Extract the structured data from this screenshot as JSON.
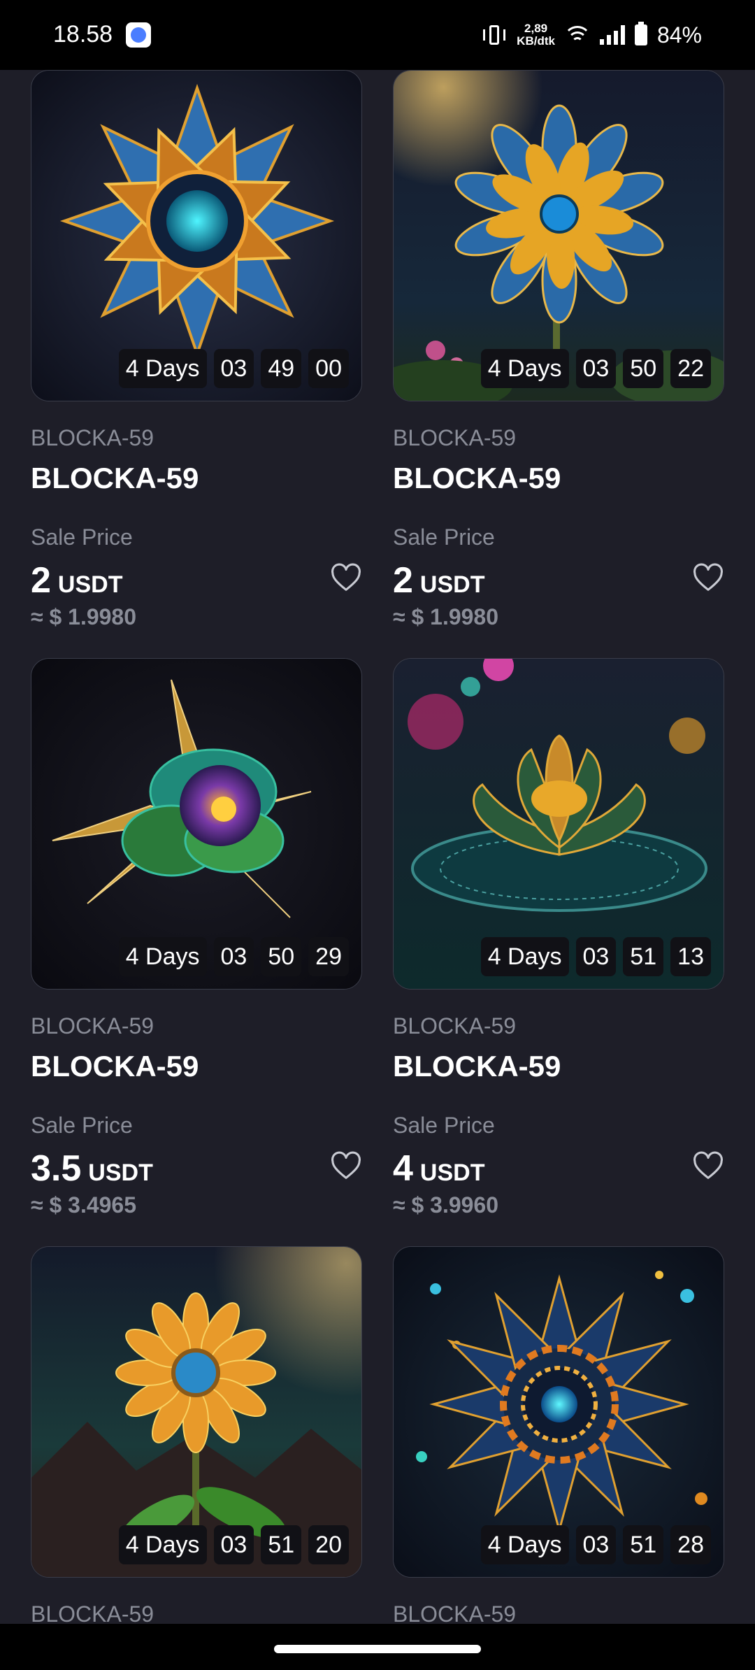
{
  "status_bar": {
    "time": "18.58",
    "net_speed_value": "2,89",
    "net_speed_unit": "KB/dtk",
    "battery": "84%"
  },
  "cards": [
    {
      "collection": "BLOCKA-59",
      "title": "BLOCKA-59",
      "sale_label": "Sale Price",
      "price": "2",
      "currency": "USDT",
      "usd": "≈ $ 1.9980",
      "timer": {
        "days": "4 Days",
        "hours": "03",
        "minutes": "49",
        "seconds": "00"
      }
    },
    {
      "collection": "BLOCKA-59",
      "title": "BLOCKA-59",
      "sale_label": "Sale Price",
      "price": "2",
      "currency": "USDT",
      "usd": "≈ $ 1.9980",
      "timer": {
        "days": "4 Days",
        "hours": "03",
        "minutes": "50",
        "seconds": "22"
      }
    },
    {
      "collection": "BLOCKA-59",
      "title": "BLOCKA-59",
      "sale_label": "Sale Price",
      "price": "3.5",
      "currency": "USDT",
      "usd": "≈ $ 3.4965",
      "timer": {
        "days": "4 Days",
        "hours": "03",
        "minutes": "50",
        "seconds": "29"
      }
    },
    {
      "collection": "BLOCKA-59",
      "title": "BLOCKA-59",
      "sale_label": "Sale Price",
      "price": "4",
      "currency": "USDT",
      "usd": "≈ $ 3.9960",
      "timer": {
        "days": "4 Days",
        "hours": "03",
        "minutes": "51",
        "seconds": "13"
      }
    },
    {
      "collection": "BLOCKA-59",
      "timer": {
        "days": "4 Days",
        "hours": "03",
        "minutes": "51",
        "seconds": "20"
      }
    },
    {
      "collection": "BLOCKA-59",
      "timer": {
        "days": "4 Days",
        "hours": "03",
        "minutes": "51",
        "seconds": "28"
      }
    }
  ]
}
